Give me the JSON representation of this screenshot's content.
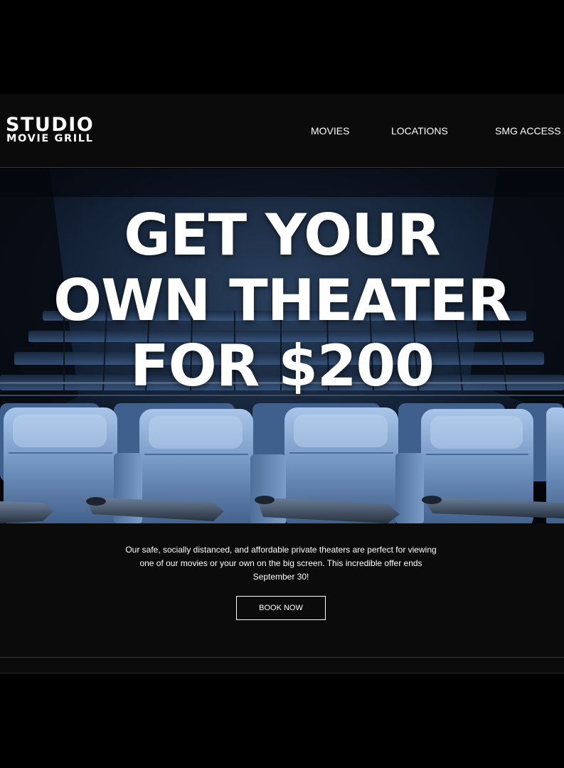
{
  "brand": {
    "logo_line1": "STUDIO",
    "logo_line2": "MOVIE GRILL"
  },
  "nav": [
    {
      "label": "MOVIES"
    },
    {
      "label": "LOCATIONS"
    },
    {
      "label": "SMG ACCESS"
    }
  ],
  "hero": {
    "headline_lines": [
      "GET YOUR",
      "OWN THEATER",
      "FOR $200"
    ]
  },
  "promo": {
    "description": "Our safe, socially distanced, and affordable private theaters are perfect for viewing one of our movies or your own on the big screen. This incredible offer ends September 30!",
    "cta_label": "BOOK NOW"
  },
  "colors": {
    "background": "#000000",
    "panel": "#0b0b0c",
    "text": "#ffffff",
    "seat_blue": "#7a9fcf"
  }
}
